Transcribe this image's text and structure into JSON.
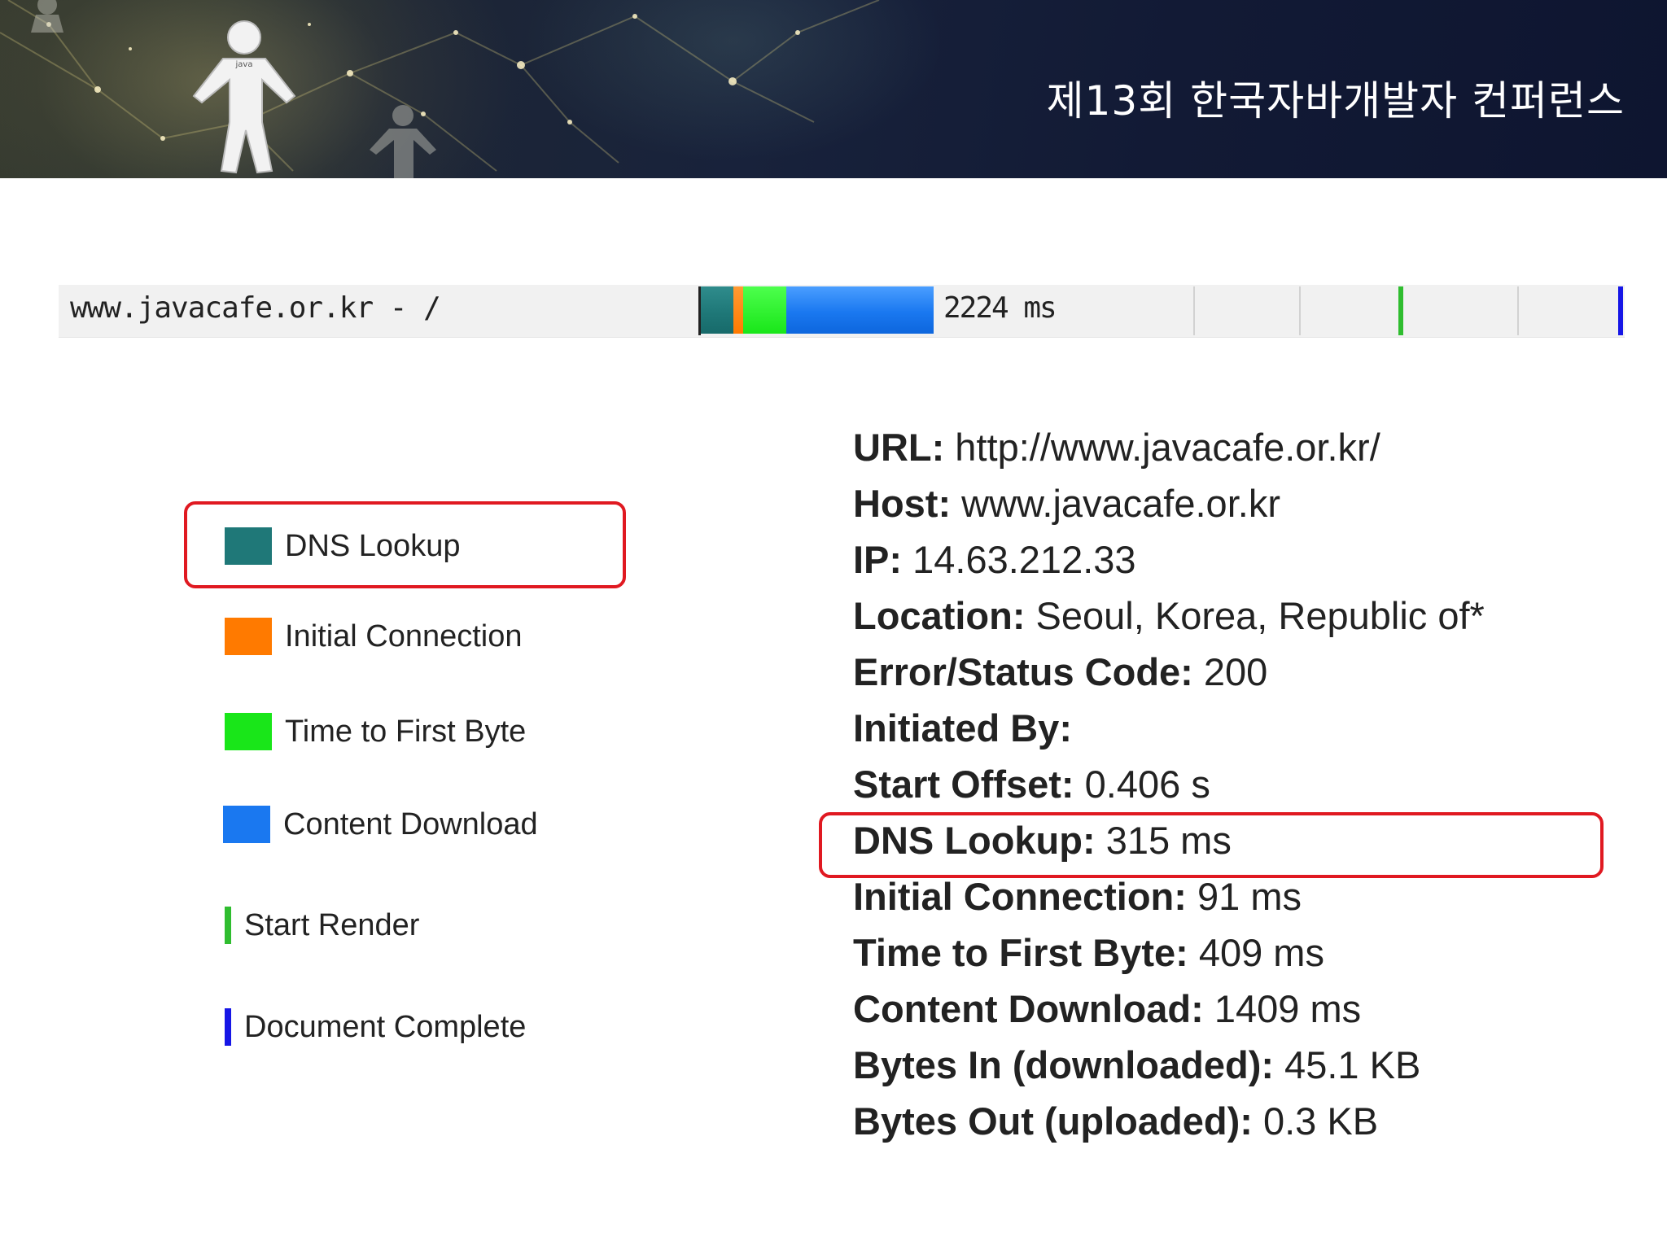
{
  "header": {
    "title": "제13회 한국자바개발자 컨퍼런스",
    "figure_label": "java"
  },
  "waterfall": {
    "request_label": "www.javacafe.or.kr - /",
    "total_time": "2224 ms",
    "timings_ms": {
      "dns": 315,
      "initial_connection": 91,
      "time_to_first_byte": 409,
      "content_download": 1409
    },
    "colors": {
      "dns": "#1f7878",
      "initial_connection": "#ff7a00",
      "time_to_first_byte": "#19e619",
      "content_download": "#1a78f0",
      "start_render": "#2fbd2f",
      "document_complete": "#1616e6"
    }
  },
  "legend": {
    "items": [
      {
        "label": "DNS Lookup",
        "kind": "swatch",
        "color": "#1f7878"
      },
      {
        "label": "Initial Connection",
        "kind": "swatch",
        "color": "#ff7a00"
      },
      {
        "label": "Time to First Byte",
        "kind": "swatch",
        "color": "#19e619"
      },
      {
        "label": "Content Download",
        "kind": "swatch",
        "color": "#1a78f0"
      },
      {
        "label": "Start Render",
        "kind": "line",
        "color": "#2fbd2f"
      },
      {
        "label": "Document Complete",
        "kind": "line",
        "color": "#1616e6"
      }
    ],
    "highlighted": "DNS Lookup"
  },
  "details": {
    "rows": [
      {
        "key": "URL:",
        "value": " http://www.javacafe.or.kr/"
      },
      {
        "key": "Host:",
        "value": " www.javacafe.or.kr"
      },
      {
        "key": "IP:",
        "value": " 14.63.212.33"
      },
      {
        "key": "Location:",
        "value": " Seoul, Korea, Republic of*"
      },
      {
        "key": "Error/Status Code:",
        "value": " 200"
      },
      {
        "key": "Initiated By:",
        "value": ""
      },
      {
        "key": "Start Offset:",
        "value": " 0.406 s"
      },
      {
        "key": "DNS Lookup:",
        "value": " 315 ms"
      },
      {
        "key": "Initial Connection:",
        "value": " 91 ms"
      },
      {
        "key": "Time to First Byte:",
        "value": " 409 ms"
      },
      {
        "key": "Content Download:",
        "value": " 1409 ms"
      },
      {
        "key": "Bytes In (downloaded):",
        "value": " 45.1 KB"
      },
      {
        "key": "Bytes Out (uploaded):",
        "value": " 0.3 KB"
      }
    ],
    "highlighted": "DNS Lookup:"
  }
}
